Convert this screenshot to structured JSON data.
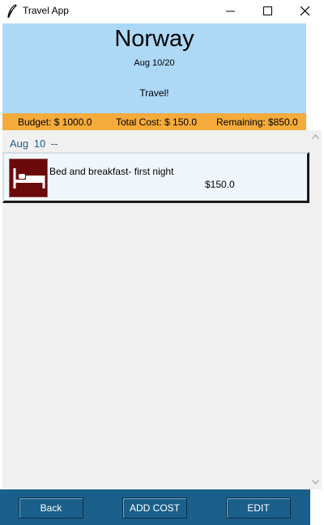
{
  "window": {
    "title": "Travel App",
    "icon": "feather-icon"
  },
  "trip": {
    "title": "Norway",
    "date": "Aug 10/20",
    "note": "Travel!"
  },
  "budget": {
    "budget_label": "Budget: $ 1000.0",
    "total_cost_label": "Total Cost: $ 150.0",
    "remaining_label": "Remaining: $850.0"
  },
  "day": {
    "label": "Aug  10 --"
  },
  "costs": [
    {
      "icon": "bed-icon",
      "description": "Bed and breakfast- first night",
      "amount": "$150.0"
    }
  ],
  "footer": {
    "back_label": "Back",
    "add_cost_label": "ADD COST",
    "edit_label": "EDIT"
  },
  "colors": {
    "header_bg": "#add8f6",
    "budget_bar_bg": "#f5ab3c",
    "footer_bg": "#1b5f8b",
    "icon_bg": "#6b0a0a"
  }
}
